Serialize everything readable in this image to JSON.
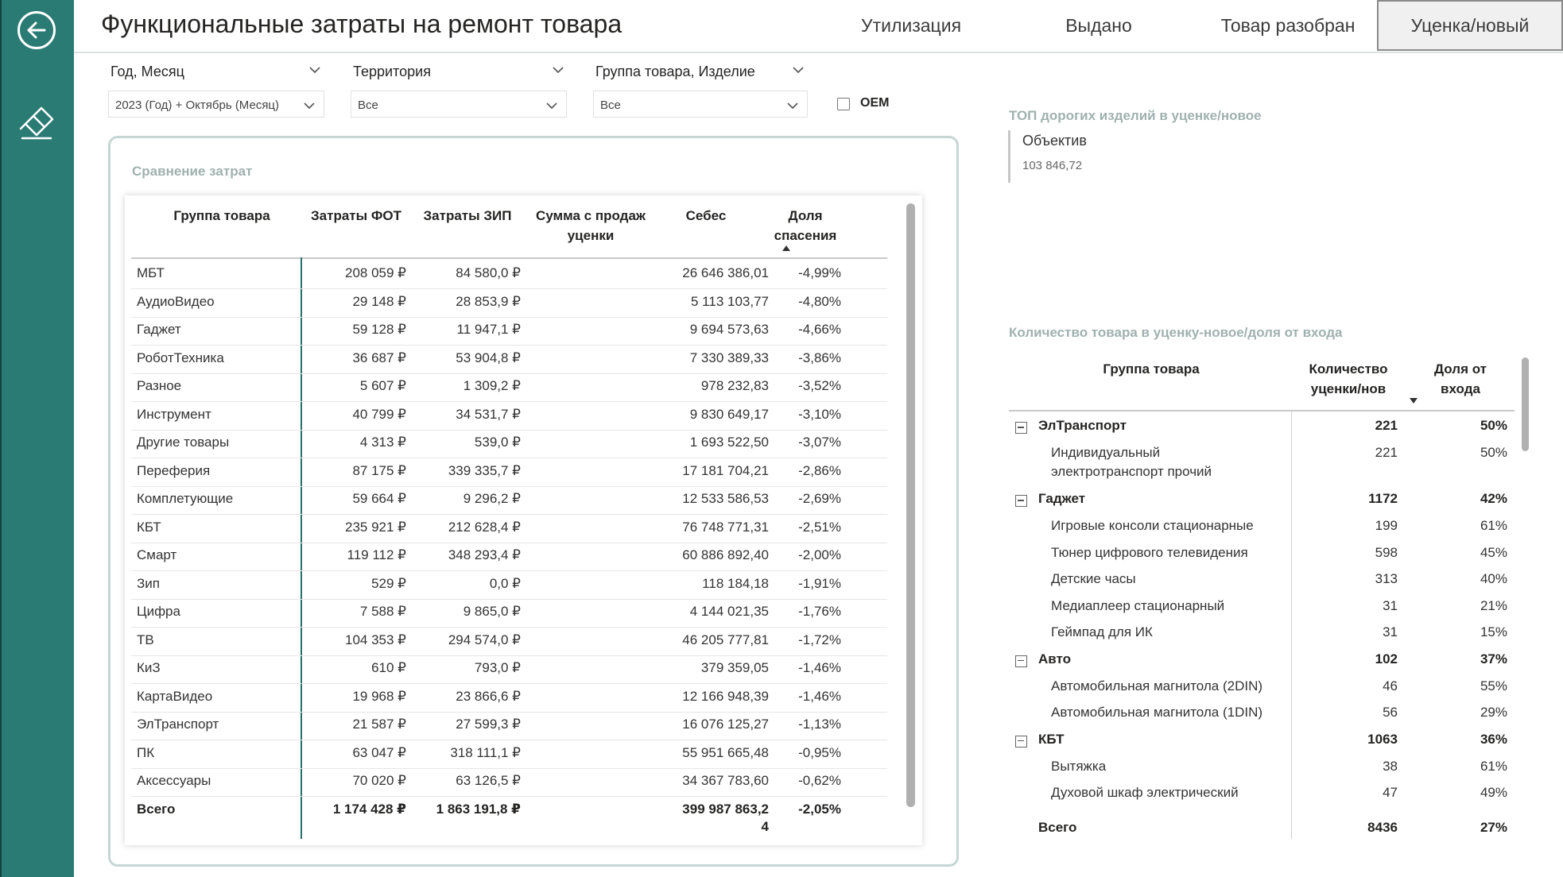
{
  "header": {
    "title": "Функциональные затраты на ремонт товара",
    "tabs": [
      {
        "label": "Утилизация",
        "active": false
      },
      {
        "label": "Выдано",
        "active": false
      },
      {
        "label": "Товар разобран",
        "active": false
      },
      {
        "label": "Уценка/новый",
        "active": true
      }
    ]
  },
  "sidebar": {
    "back_icon": "arrow-left-circle-icon",
    "clear_icon": "eraser-icon"
  },
  "filters": {
    "period": {
      "label": "Год, Месяц",
      "value": "2023 (Год) + Октябрь (Месяц)"
    },
    "territory": {
      "label": "Территория",
      "value": "Все"
    },
    "group": {
      "label": "Группа товара, Изделие",
      "value": "Все"
    },
    "oem": {
      "label": "OEM",
      "checked": false
    }
  },
  "comparison": {
    "title": "Сравнение затрат",
    "columns": {
      "group": "Группа товара",
      "fot": "Затраты ФОТ",
      "zip": "Затраты ЗИП",
      "sales1": "Сумма с продаж",
      "sales2": "уценки",
      "cost": "Себес",
      "share1": "Доля",
      "share2": "спасения"
    },
    "rows": [
      {
        "group": "МБТ",
        "fot": "208 059 ₽",
        "zip": "84 580,0 ₽",
        "cost": "26 646 386,01",
        "share": "-4,99%"
      },
      {
        "group": "АудиоВидео",
        "fot": "29 148 ₽",
        "zip": "28 853,9 ₽",
        "cost": "5 113 103,77",
        "share": "-4,80%"
      },
      {
        "group": "Гаджет",
        "fot": "59 128 ₽",
        "zip": "11 947,1 ₽",
        "cost": "9 694 573,63",
        "share": "-4,66%"
      },
      {
        "group": "РоботТехника",
        "fot": "36 687 ₽",
        "zip": "53 904,8 ₽",
        "cost": "7 330 389,33",
        "share": "-3,86%"
      },
      {
        "group": "Разное",
        "fot": "5 607 ₽",
        "zip": "1 309,2 ₽",
        "cost": "978 232,83",
        "share": "-3,52%"
      },
      {
        "group": "Инструмент",
        "fot": "40 799 ₽",
        "zip": "34 531,7 ₽",
        "cost": "9 830 649,17",
        "share": "-3,10%"
      },
      {
        "group": "Другие товары",
        "fot": "4 313 ₽",
        "zip": "539,0 ₽",
        "cost": "1 693 522,50",
        "share": "-3,07%"
      },
      {
        "group": "Переферия",
        "fot": "87 175 ₽",
        "zip": "339 335,7 ₽",
        "cost": "17 181 704,21",
        "share": "-2,86%"
      },
      {
        "group": "Комплетующие",
        "fot": "59 664 ₽",
        "zip": "9 296,2 ₽",
        "cost": "12 533 586,53",
        "share": "-2,69%"
      },
      {
        "group": "КБТ",
        "fot": "235 921 ₽",
        "zip": "212 628,4 ₽",
        "cost": "76 748 771,31",
        "share": "-2,51%"
      },
      {
        "group": "Смарт",
        "fot": "119 112 ₽",
        "zip": "348 293,4 ₽",
        "cost": "60 886 892,40",
        "share": "-2,00%"
      },
      {
        "group": "Зип",
        "fot": "529 ₽",
        "zip": "0,0 ₽",
        "cost": "118 184,18",
        "share": "-1,91%"
      },
      {
        "group": "Цифра",
        "fot": "7 588 ₽",
        "zip": "9 865,0 ₽",
        "cost": "4 144 021,35",
        "share": "-1,76%"
      },
      {
        "group": "ТВ",
        "fot": "104 353 ₽",
        "zip": "294 574,0 ₽",
        "cost": "46 205 777,81",
        "share": "-1,72%"
      },
      {
        "group": "КиЗ",
        "fot": "610 ₽",
        "zip": "793,0 ₽",
        "cost": "379 359,05",
        "share": "-1,46%"
      },
      {
        "group": "КартаВидео",
        "fot": "19 968 ₽",
        "zip": "23 866,6 ₽",
        "cost": "12 166 948,39",
        "share": "-1,46%"
      },
      {
        "group": "ЭлТранспорт",
        "fot": "21 587 ₽",
        "zip": "27 599,3 ₽",
        "cost": "16 076 125,27",
        "share": "-1,13%"
      },
      {
        "group": "ПК",
        "fot": "63 047 ₽",
        "zip": "318 111,1 ₽",
        "cost": "55 951 665,48",
        "share": "-0,95%"
      },
      {
        "group": "Аксессуары",
        "fot": "70 020 ₽",
        "zip": "63 126,5 ₽",
        "cost": "34 367 783,60",
        "share": "-0,62%"
      }
    ],
    "total": {
      "group": "Всего",
      "fot": "1 174 428 ₽",
      "zip": "1 863 191,8 ₽",
      "cost1": "399 987 863,2",
      "cost2": "4",
      "share": "-2,05%"
    }
  },
  "top_items": {
    "title": "ТОП дорогих изделий в уценке/новое",
    "name": "Объектив",
    "value": "103 846,72"
  },
  "count_table": {
    "title": "Количество товара в уценку-новое/доля от входа",
    "columns": {
      "group": "Группа товара",
      "qty1": "Количество",
      "qty2": "уценки/нов",
      "share1": "Доля от",
      "share2": "входа"
    },
    "rows": [
      {
        "kind": "group",
        "name": "ЭлТранспорт",
        "qty": "221",
        "share": "50%"
      },
      {
        "kind": "item",
        "name": "Индивидуальный",
        "name2": "электротранспорт прочий",
        "qty": "221",
        "share": "50%"
      },
      {
        "kind": "group",
        "name": "Гаджет",
        "qty": "1172",
        "share": "42%"
      },
      {
        "kind": "item",
        "name": "Игровые консоли стационарные",
        "qty": "199",
        "share": "61%"
      },
      {
        "kind": "item",
        "name": "Тюнер цифрового телевидения",
        "qty": "598",
        "share": "45%"
      },
      {
        "kind": "item",
        "name": "Детские часы",
        "qty": "313",
        "share": "40%"
      },
      {
        "kind": "item",
        "name": "Медиаплеер стационарный",
        "qty": "31",
        "share": "21%"
      },
      {
        "kind": "item",
        "name": "Геймпад для ИК",
        "qty": "31",
        "share": "15%"
      },
      {
        "kind": "group",
        "name": "Авто",
        "qty": "102",
        "share": "37%"
      },
      {
        "kind": "item",
        "name": "Автомобильная магнитола (2DIN)",
        "qty": "46",
        "share": "55%"
      },
      {
        "kind": "item",
        "name": "Автомобильная магнитола (1DIN)",
        "qty": "56",
        "share": "29%"
      },
      {
        "kind": "group",
        "name": "КБТ",
        "qty": "1063",
        "share": "36%"
      },
      {
        "kind": "item",
        "name": "Вытяжка",
        "qty": "38",
        "share": "61%"
      },
      {
        "kind": "item",
        "name": "Духовой шкаф электрический",
        "qty": "47",
        "share": "49%"
      }
    ],
    "total": {
      "name": "Всего",
      "qty": "8436",
      "share": "27%"
    }
  },
  "colors": {
    "sidebar": "#2b7b75",
    "accent_line": "#2b6f6a",
    "panel_title": "#9fb1af"
  }
}
